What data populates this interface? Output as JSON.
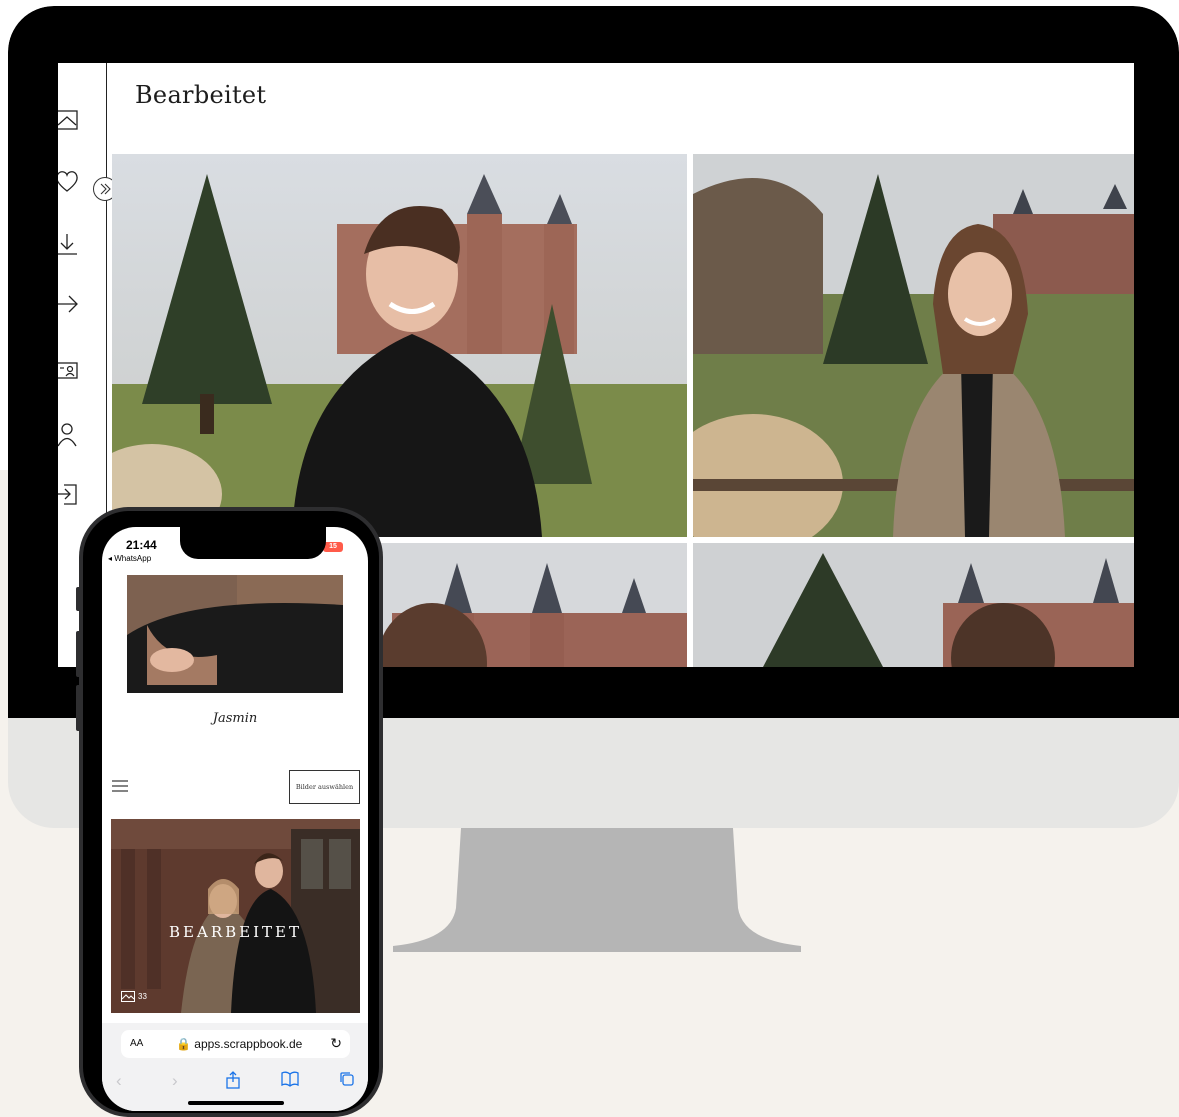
{
  "desktop": {
    "page_title": "Bearbeitet",
    "sidebar": {
      "icons": [
        "image-icon",
        "heart-icon",
        "download-icon",
        "share-icon",
        "contact-card-icon",
        "user-icon",
        "login-icon"
      ],
      "collapse_icon": "double-chevron-right-icon"
    }
  },
  "phone": {
    "status": {
      "time": "21:44",
      "back_app": "◂ WhatsApp",
      "battery": "15"
    },
    "gallery_name": "Jasmin",
    "select_button_label": "Bilder auswählen",
    "collection": {
      "title": "BEARBEITET",
      "count": "33"
    },
    "browser": {
      "text_size_label": "AA",
      "url": "🔒 apps.scrappbook.de",
      "reload_icon": "↻"
    }
  },
  "colors": {
    "accent": "#1a73e8",
    "battery": "#ff5b4a",
    "page_bg": "#f5f2ed",
    "bezel": "#000000"
  }
}
